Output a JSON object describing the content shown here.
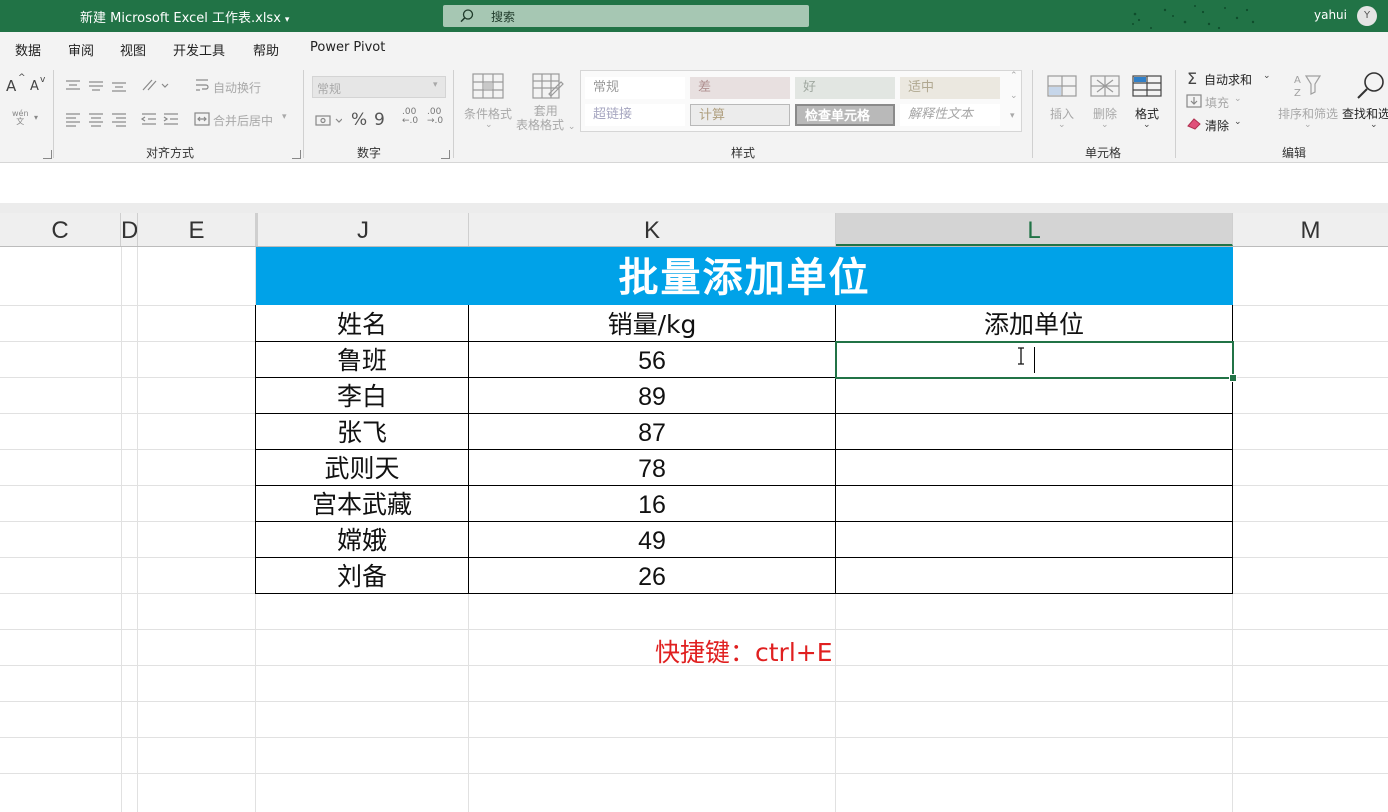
{
  "window": {
    "doc_title": "新建 Microsoft Excel 工作表.xlsx",
    "search_placeholder": "搜索",
    "user_name": "yahui",
    "avatar_initial": "Y"
  },
  "tabs": [
    "数据",
    "审阅",
    "视图",
    "开发工具",
    "帮助",
    "Power Pivot"
  ],
  "ribbon": {
    "font": {
      "grow": "A",
      "shrink": "A",
      "phonetic": "wén\n文"
    },
    "alignment": {
      "label": "对齐方式",
      "wrap_text": "自动换行",
      "merge_center": "合并后居中"
    },
    "number": {
      "label": "数字",
      "format_value": "常规",
      "percent": "%",
      "comma": "9",
      "inc_decimal": ".00",
      "dec_decimal": ".00"
    },
    "styles": {
      "label": "样式",
      "conditional": "条件格式",
      "table_format_1": "套用",
      "table_format_2": "表格格式",
      "cells": [
        [
          "常规",
          "差",
          "好",
          "适中"
        ],
        [
          "超链接",
          "计算",
          "检查单元格",
          "解释性文本"
        ]
      ]
    },
    "cells_group": {
      "label": "单元格",
      "insert": "插入",
      "delete": "删除",
      "format": "格式"
    },
    "editing": {
      "label": "编辑",
      "autosum": "自动求和",
      "fill": "填充",
      "clear": "清除",
      "sort_filter": "排序和筛选",
      "find_select": "查找和选"
    }
  },
  "columns": [
    "C",
    "D",
    "E",
    "J",
    "K",
    "L",
    "M"
  ],
  "sheet": {
    "banner": "批量添加单位",
    "headers": [
      "姓名",
      "销量/kg",
      "添加单位"
    ],
    "rows": [
      [
        "鲁班",
        "56",
        ""
      ],
      [
        "李白",
        "89",
        ""
      ],
      [
        "张飞",
        "87",
        ""
      ],
      [
        "武则天",
        "78",
        ""
      ],
      [
        "宫本武藏",
        "16",
        ""
      ],
      [
        "嫦娥",
        "49",
        ""
      ],
      [
        "刘备",
        "26",
        ""
      ]
    ],
    "shortcut": "快捷键：ctrl+E"
  },
  "colors": {
    "excel_green": "#217346",
    "banner_blue": "#00a2e8",
    "shortcut_red": "#e02020"
  }
}
